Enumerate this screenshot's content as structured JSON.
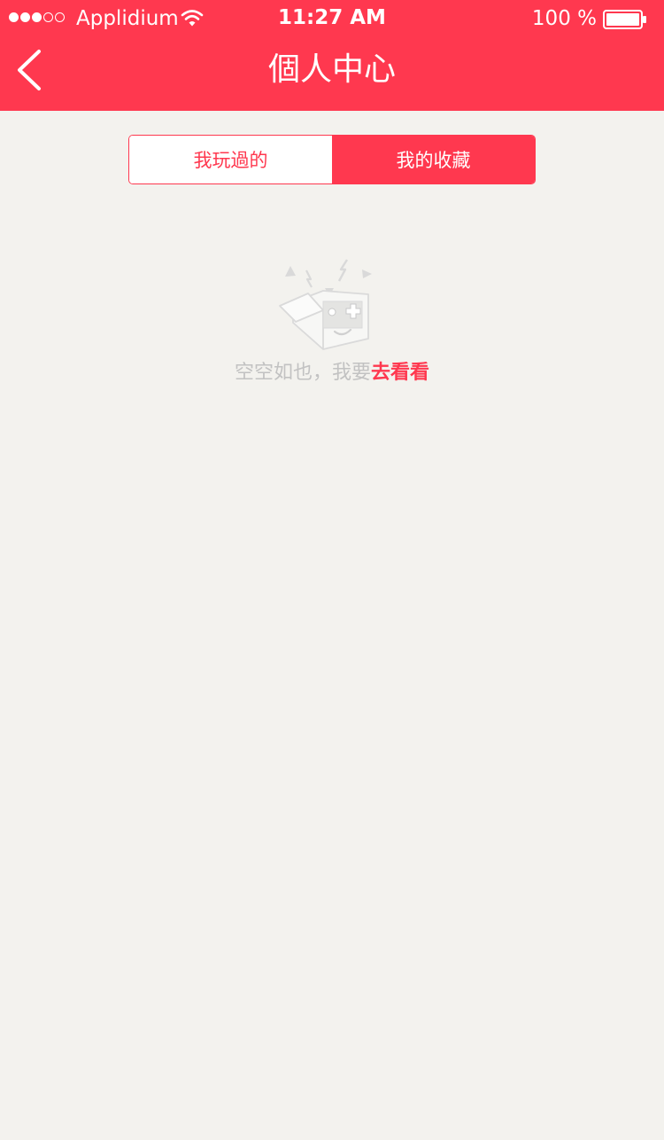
{
  "status_bar": {
    "carrier": "Applidium",
    "time": "11:27 AM",
    "battery": "100 %",
    "signal_icon": "signal-dots-icon",
    "wifi_icon": "wifi-icon",
    "battery_icon": "battery-icon"
  },
  "header": {
    "title": "個人中心",
    "back_icon": "chevron-left-icon"
  },
  "tabs": [
    {
      "label": "我玩過的",
      "selected": false
    },
    {
      "label": "我的收藏",
      "selected": true
    }
  ],
  "empty_state": {
    "icon": "empty-box-icon",
    "message": "空空如也，我要",
    "link": "去看看"
  },
  "colors": {
    "accent": "#ff384f",
    "background": "#f3f2ee",
    "muted_text": "#c2c2c2"
  }
}
